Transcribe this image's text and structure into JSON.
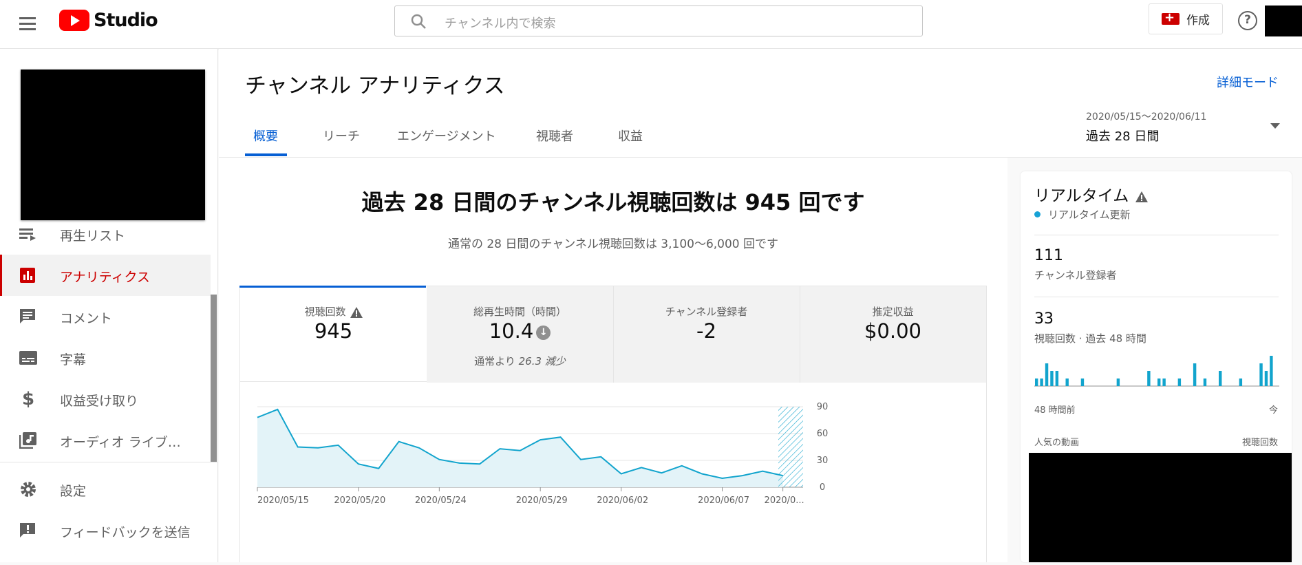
{
  "topbar": {
    "logo_text": "Studio",
    "search_placeholder": "チャンネル内で検索",
    "create_label": "作成"
  },
  "sidebar": {
    "items": [
      {
        "label": "再生リスト",
        "icon": "playlist-icon"
      },
      {
        "label": "アナリティクス",
        "icon": "analytics-icon",
        "active": true
      },
      {
        "label": "コメント",
        "icon": "comment-icon"
      },
      {
        "label": "字幕",
        "icon": "subtitles-icon"
      },
      {
        "label": "収益受け取り",
        "icon": "dollar-icon"
      },
      {
        "label": "オーディオ ライブ…",
        "icon": "audio-library-icon"
      }
    ],
    "bottom_items": [
      {
        "label": "設定",
        "icon": "gear-icon"
      },
      {
        "label": "フィードバックを送信",
        "icon": "feedback-icon"
      }
    ]
  },
  "header": {
    "title": "チャンネル アナリティクス",
    "advanced_mode": "詳細モード",
    "tabs": [
      "概要",
      "リーチ",
      "エンゲージメント",
      "視聴者",
      "収益"
    ],
    "active_tab": "概要",
    "date_range": "2020/05/15～2020/06/11",
    "period": "過去 28 日間"
  },
  "overview": {
    "headline": "過去 28 日間のチャンネル視聴回数は 945 回です",
    "subline": "通常の 28 日間のチャンネル視聴回数は 3,100～6,000 回です",
    "cards": [
      {
        "title": "視聴回数",
        "value": "945",
        "warning": true
      },
      {
        "title": "総再生時間（時間）",
        "value": "10.4",
        "trend": "down",
        "note_prefix": "通常より ",
        "note_em": "26.3 減少"
      },
      {
        "title": "チャンネル登録者",
        "value": "-2"
      },
      {
        "title": "推定収益",
        "value": "$0.00"
      }
    ]
  },
  "chart_data": {
    "type": "area",
    "x_tick_labels": [
      "2020/05/15",
      "2020/05/20",
      "2020/05/24",
      "2020/05/29",
      "2020/06/02",
      "2020/06/07",
      "2020/0..."
    ],
    "y_ticks": [
      0,
      30,
      60,
      90
    ],
    "ylim": [
      0,
      90
    ],
    "values": [
      78,
      87,
      45,
      44,
      47,
      26,
      21,
      51,
      44,
      31,
      27,
      26,
      43,
      41,
      53,
      56,
      31,
      34,
      15,
      22,
      16,
      24,
      15,
      10,
      13,
      18,
      13
    ],
    "color": "#12a4cd",
    "incomplete_period_hatched": true
  },
  "realtime": {
    "title": "リアルタイム",
    "live_label": "リアルタイム更新",
    "subscribers_value": "111",
    "subscribers_label": "チャンネル登録者",
    "views_value": "33",
    "views_label": "視聴回数 · 過去 48 時間",
    "bars": [
      1,
      1,
      3,
      2,
      2,
      0,
      1,
      0,
      0,
      1,
      0,
      0,
      0,
      0,
      0,
      0,
      1,
      0,
      0,
      0,
      0,
      0,
      2,
      0,
      1,
      1,
      0,
      0,
      1,
      0,
      0,
      3,
      0,
      1,
      0,
      0,
      2,
      0,
      0,
      0,
      1,
      0,
      0,
      0,
      3,
      2,
      4,
      0
    ],
    "axis_start": "48 時間前",
    "axis_end": "今",
    "popular_label": "人気の動画",
    "views_col_label": "視聴回数"
  }
}
